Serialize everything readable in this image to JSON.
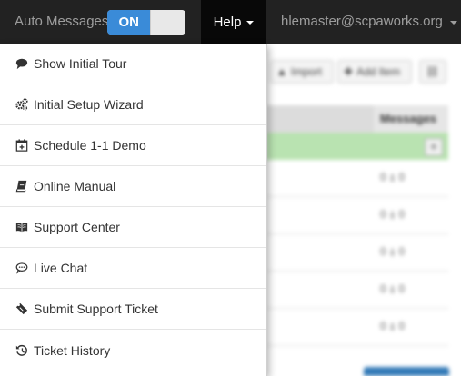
{
  "navbar": {
    "auto_messages_label": "Auto Messages",
    "toggle_state": "ON",
    "help_label": "Help",
    "user_email": "hlemaster@scpaworks.org"
  },
  "help_menu": {
    "items": [
      {
        "label": "Show Initial Tour",
        "icon": "comment-icon"
      },
      {
        "label": "Initial Setup Wizard",
        "icon": "gears-icon"
      },
      {
        "label": "Schedule 1-1 Demo",
        "icon": "calendar-plus-icon"
      },
      {
        "label": "Online Manual",
        "icon": "book-icon"
      },
      {
        "label": "Support Center",
        "icon": "open-book-icon"
      },
      {
        "label": "Live Chat",
        "icon": "chat-bubble-icon"
      },
      {
        "label": "Submit Support Ticket",
        "icon": "ticket-icon"
      },
      {
        "label": "Ticket History",
        "icon": "history-icon"
      }
    ]
  },
  "background": {
    "toolbar": {
      "import_label": "Import",
      "add_label": "Add Item"
    },
    "messages_header": "Messages",
    "row_counts": [
      "0 ⍋ 0",
      "0 ⍋ 0",
      "0 ⍋ 0",
      "0 ⍋ 0",
      "0 ⍋ 0"
    ]
  },
  "colors": {
    "navbar_bg": "#222222",
    "help_active_bg": "#080808",
    "toggle_on": "#3a8bd8",
    "green_row": "#b9e3b1"
  }
}
